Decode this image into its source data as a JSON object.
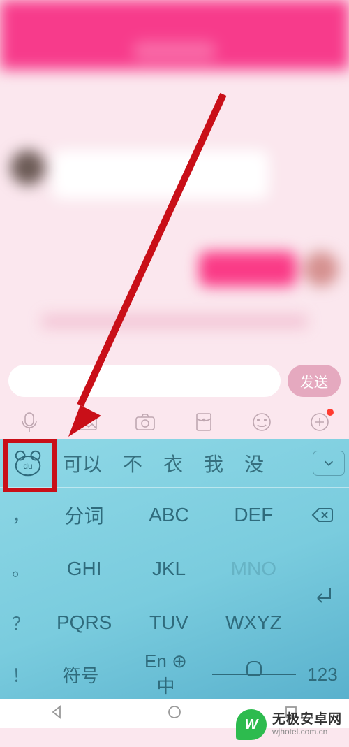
{
  "input_bar": {
    "send_label": "发送"
  },
  "candidates": [
    "可以",
    "不",
    "衣",
    "我",
    "没"
  ],
  "side_keys": [
    "，",
    "。",
    "？",
    "！"
  ],
  "grid": {
    "r1": [
      "分词",
      "ABC",
      "DEF"
    ],
    "r2": [
      "GHI",
      "JKL",
      "MNO"
    ],
    "r3": [
      "PQRS",
      "TUV",
      "WXYZ"
    ]
  },
  "bottom": {
    "symbol": "符号",
    "lang_top": "En",
    "lang_main": "中",
    "num": "123"
  },
  "watermark": {
    "icon_text": "W",
    "title": "无极安卓网",
    "url": "wjhotel.com.cn"
  }
}
